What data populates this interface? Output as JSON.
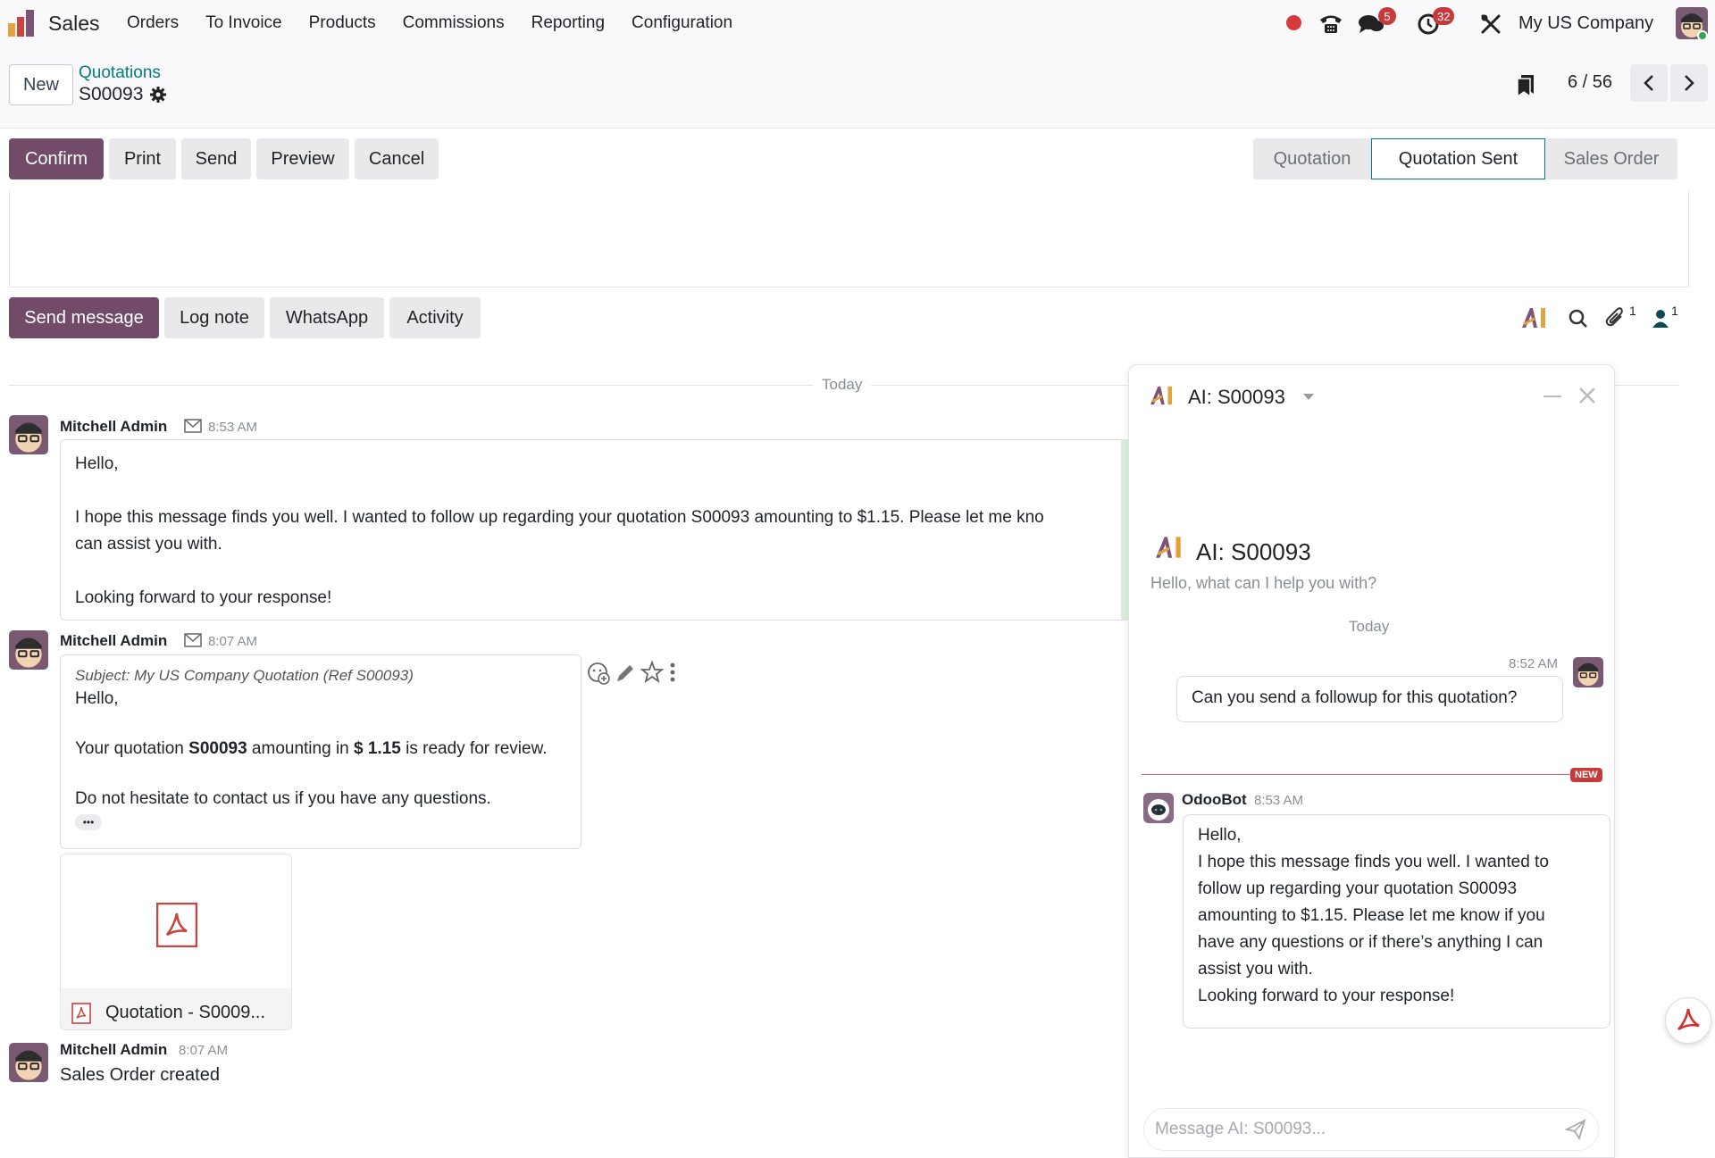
{
  "navbar": {
    "app_name": "Sales",
    "menu": [
      "Orders",
      "To Invoice",
      "Products",
      "Commissions",
      "Reporting",
      "Configuration"
    ],
    "messages_badge": "5",
    "activities_badge": "32",
    "company": "My US Company",
    "icons": [
      "recording-indicator-icon",
      "phone-icon",
      "chat-icon",
      "clock-icon",
      "tools-icon"
    ]
  },
  "control_panel": {
    "new_label": "New",
    "breadcrumb_parent": "Quotations",
    "breadcrumb_current": "S00093",
    "pager": "6 / 56"
  },
  "actions": {
    "confirm": "Confirm",
    "print": "Print",
    "send": "Send",
    "preview": "Preview",
    "cancel": "Cancel"
  },
  "statusbar": {
    "steps": [
      "Quotation",
      "Quotation Sent",
      "Sales Order"
    ],
    "current": "Quotation Sent"
  },
  "chatter": {
    "send_message": "Send message",
    "log_note": "Log note",
    "whatsapp": "WhatsApp",
    "activity": "Activity",
    "attachments_count": "1",
    "followers_count": "1",
    "today": "Today",
    "messages": [
      {
        "author": "Mitchell Admin",
        "time": "8:53 AM",
        "lines": [
          "Hello,",
          "I hope this message finds you well. I wanted to follow up regarding your quotation S00093 amounting to $1.15. Please let me kno",
          "can assist you with.",
          "Looking forward to your response!"
        ]
      },
      {
        "author": "Mitchell Admin",
        "time": "8:07 AM",
        "subject": "Subject: My US Company Quotation (Ref S00093)",
        "greeting": "Hello,",
        "body_pre": "Your quotation ",
        "body_ref": "S00093",
        "body_mid": " amounting in ",
        "body_amount": "$ 1.15",
        "body_post": " is ready for review.",
        "closing": "Do not hesitate to contact us if you have any questions.",
        "more": "•••",
        "attachment": "Quotation - S0009..."
      },
      {
        "author": "Mitchell Admin",
        "time": "8:07 AM",
        "body": "Sales Order created"
      }
    ]
  },
  "ai_panel": {
    "title": "AI: S00093",
    "intro_title": "AI: S00093",
    "intro_sub": "Hello, what can I help you with?",
    "today": "Today",
    "user_time": "8:52 AM",
    "user_message": "Can you send a followup for this quotation?",
    "new_badge": "NEW",
    "bot_name": "OdooBot",
    "bot_time": "8:53 AM",
    "bot_lines": [
      "Hello,",
      "I hope this message finds you well. I wanted to",
      "follow up regarding your quotation S00093",
      "amounting to $1.15. Please let me know if you",
      "have any questions or if there’s anything I can",
      "assist you with.",
      "Looking forward to your response!"
    ],
    "input_placeholder": "Message AI: S00093..."
  },
  "colors": {
    "primary": "#714b67",
    "teal": "#017e84",
    "badge": "#c63a3a",
    "recording": "#d63a3a"
  }
}
